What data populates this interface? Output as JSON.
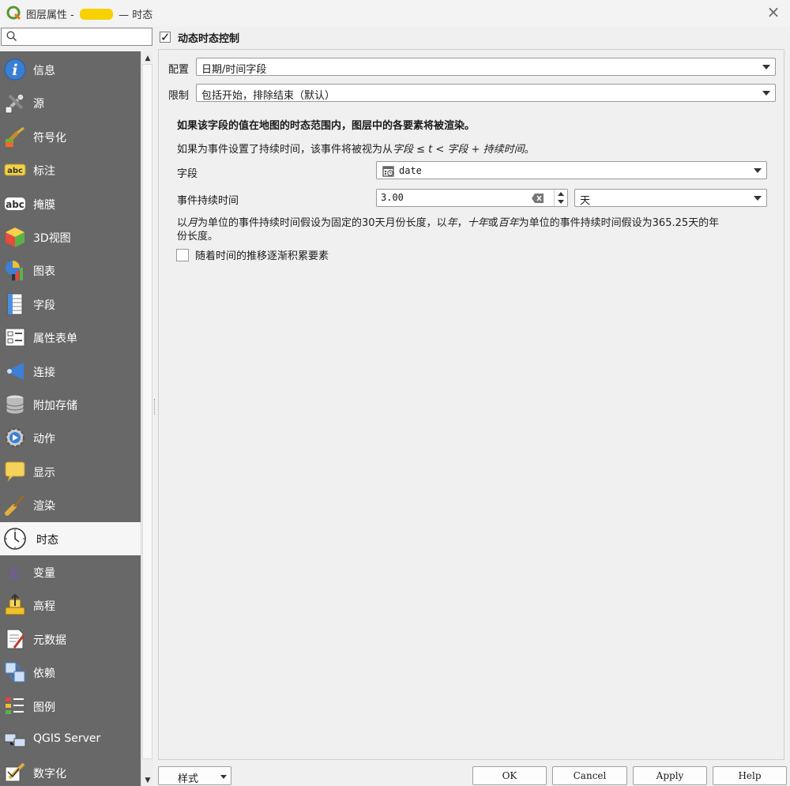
{
  "window": {
    "title_prefix": "图层属性 - ",
    "title_suffix": " — 时态"
  },
  "search": {
    "placeholder": ""
  },
  "sidebar": {
    "items": [
      {
        "label": "信息",
        "icon": "info-icon"
      },
      {
        "label": "源",
        "icon": "source-tools-icon"
      },
      {
        "label": "符号化",
        "icon": "paintbrush-symbology-icon"
      },
      {
        "label": "标注",
        "icon": "abc-label-icon"
      },
      {
        "label": "掩膜",
        "icon": "abc-mask-icon"
      },
      {
        "label": "3D视图",
        "icon": "3d-cube-icon"
      },
      {
        "label": "图表",
        "icon": "diagram-icon"
      },
      {
        "label": "字段",
        "icon": "fields-icon"
      },
      {
        "label": "属性表单",
        "icon": "attribute-form-icon"
      },
      {
        "label": "连接",
        "icon": "join-icon"
      },
      {
        "label": "附加存储",
        "icon": "database-storage-icon"
      },
      {
        "label": "动作",
        "icon": "action-gear-icon"
      },
      {
        "label": "显示",
        "icon": "display-speech-icon"
      },
      {
        "label": "渲染",
        "icon": "rendering-brush-icon"
      },
      {
        "label": "时态",
        "icon": "clock-icon",
        "active": true
      },
      {
        "label": "变量",
        "icon": "epsilon-variable-icon"
      },
      {
        "label": "高程",
        "icon": "elevation-icon"
      },
      {
        "label": "元数据",
        "icon": "metadata-icon"
      },
      {
        "label": "依赖",
        "icon": "dependencies-icon"
      },
      {
        "label": "图例",
        "icon": "legend-icon"
      },
      {
        "label": "QGIS Server",
        "icon": "qgis-server-icon"
      },
      {
        "label": "数字化",
        "icon": "digitizing-icon"
      }
    ]
  },
  "temporal": {
    "enable_label": "动态时态控制",
    "enabled": true,
    "config_label": "配置",
    "config_value": "日期/时间字段",
    "limits_label": "限制",
    "limits_value": "包括开始，排除结束（默认）",
    "heading": "如果该字段的值在地图的时态范围内，图层中的各要素将被渲染。",
    "event_note_prefix": "如果为事件设置了持续时间，该事件将被视为从",
    "event_note_formula": "字段 ≤ t < 字段 + 持续时间",
    "event_note_suffix": "。",
    "field_label": "字段",
    "field_value": "date",
    "duration_label": "事件持续时间",
    "duration_value": "3.00",
    "duration_unit": "天",
    "unit_note_1a": "以",
    "unit_note_month": "月",
    "unit_note_1b": "为单位的事件持续时间假设为固定的30天月份长度，以",
    "unit_note_year": "年",
    "unit_note_1c": "，",
    "unit_note_decade": "十年",
    "unit_note_1d": "或",
    "unit_note_century": "百年",
    "unit_note_1e": "为单位的事件持续时间假设为365.25天的年",
    "unit_note_2": "份长度。",
    "accumulate_label": "随着时间的推移逐渐积累要素",
    "accumulate_checked": false
  },
  "buttons": {
    "style": "样式",
    "ok": "OK",
    "cancel": "Cancel",
    "apply": "Apply",
    "help": "Help"
  }
}
